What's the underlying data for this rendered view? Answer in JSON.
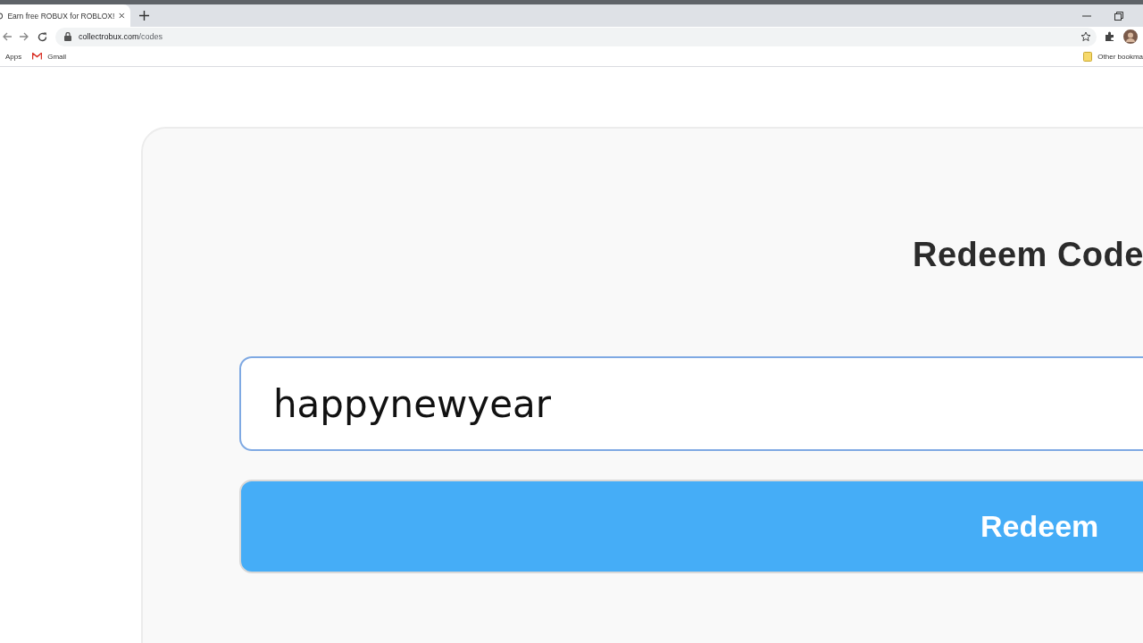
{
  "browser": {
    "tab_title": "Earn free ROBUX for ROBLOX!",
    "url_domain": "collectrobux.com",
    "url_path": "/codes",
    "bookmarks": [
      "Apps",
      "Gmail"
    ],
    "other_bookmarks": "Other bookma"
  },
  "page": {
    "title": "Redeem Code",
    "code_value": "happynewyear",
    "button": "Redeem"
  }
}
